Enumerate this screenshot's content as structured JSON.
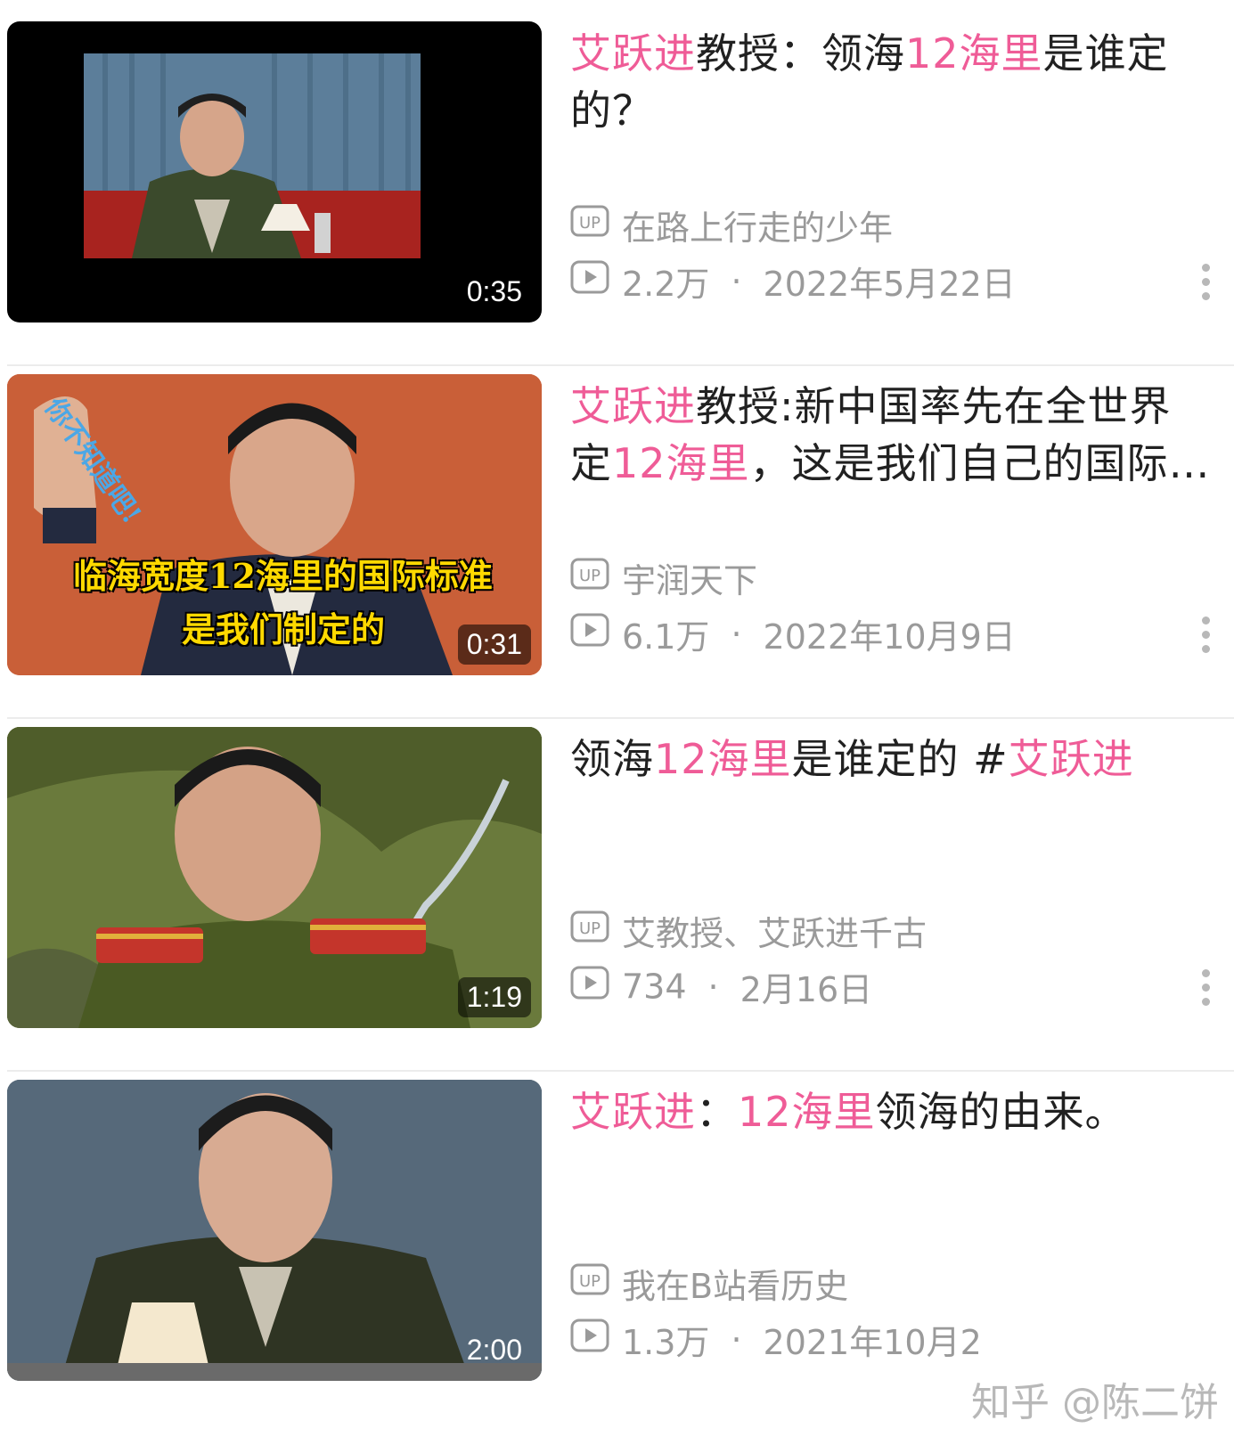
{
  "videos": [
    {
      "title_parts": [
        {
          "text": "艾跃进",
          "hl": true
        },
        {
          "text": "教授：领海",
          "hl": false
        },
        {
          "text": "12海里",
          "hl": true
        },
        {
          "text": "是谁定的？",
          "hl": false
        }
      ],
      "uploader": "在路上行走的少年",
      "views": "2.2万",
      "date": "2022年5月22日",
      "duration": "0:35"
    },
    {
      "title_parts": [
        {
          "text": "艾跃进",
          "hl": true
        },
        {
          "text": "教授:新中国率先在全世界定",
          "hl": false
        },
        {
          "text": "12海里",
          "hl": true
        },
        {
          "text": "，这是我们自己的国际标准",
          "hl": false
        }
      ],
      "uploader": "宇润天下",
      "views": "6.1万",
      "date": "2022年10月9日",
      "duration": "0:31",
      "thumb_caption_1": "你不知道吧!",
      "thumb_caption_2": "临海宽度12海里的国际标准",
      "thumb_caption_3": "是我们制定的"
    },
    {
      "title_parts": [
        {
          "text": "领海",
          "hl": false
        },
        {
          "text": "12海里",
          "hl": true
        },
        {
          "text": "是谁定的 #",
          "hl": false
        },
        {
          "text": "艾跃进",
          "hl": true
        }
      ],
      "uploader": "艾教授、艾跃进千古",
      "views": "734",
      "date": "2月16日",
      "duration": "1:19"
    },
    {
      "title_parts": [
        {
          "text": "艾跃进",
          "hl": true
        },
        {
          "text": "：",
          "hl": false
        },
        {
          "text": "12海里",
          "hl": true
        },
        {
          "text": "领海的由来。",
          "hl": false
        }
      ],
      "uploader": "我在B站看历史",
      "views": "1.3万",
      "date": "2021年10月2",
      "duration": "2:00"
    }
  ],
  "separator": "·",
  "watermark": "知乎 @陈二饼",
  "colors": {
    "highlight": "#ef5c97",
    "meta": "#9a9a9a",
    "title": "#212121"
  },
  "icons": {
    "uploader": "up-badge-icon",
    "views": "play-count-icon",
    "more": "more-vertical-icon"
  }
}
